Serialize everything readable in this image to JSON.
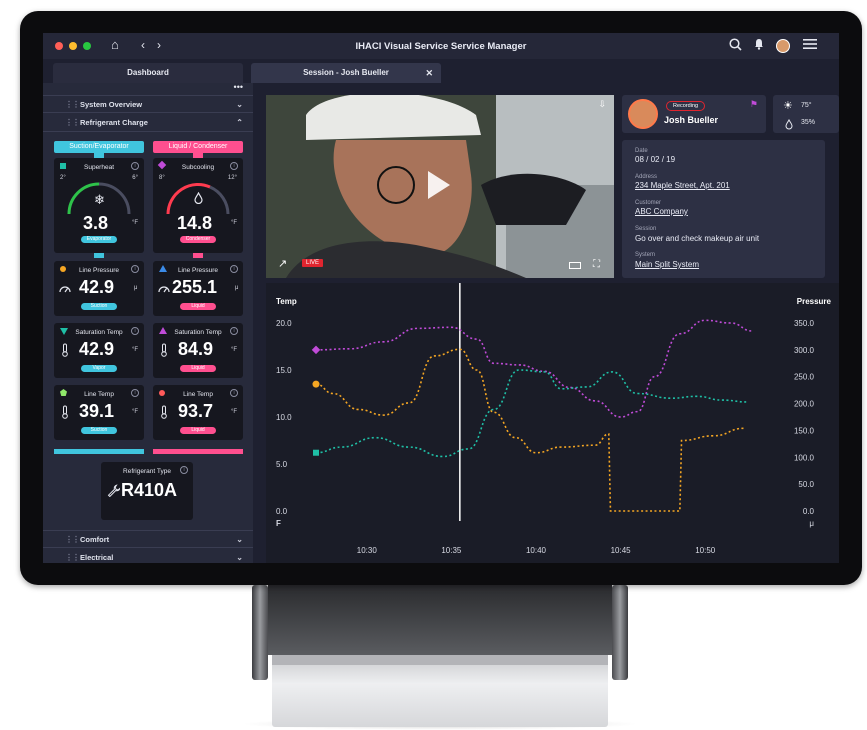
{
  "app": {
    "title": "IHACI Visual Service Service Manager"
  },
  "tabs": [
    {
      "label": "Dashboard"
    },
    {
      "label": "Session - Josh Bueller"
    }
  ],
  "sidebar": {
    "sections": {
      "system_overview": "System Overview",
      "refrigerant_charge": "Refrigerant Charge",
      "comfort": "Comfort",
      "electrical": "Electrical"
    },
    "column_labels": {
      "left": "Suction/Evaporator",
      "right": "Liquid / Condenser"
    },
    "superheat": {
      "title": "Superheat",
      "value": "3.8",
      "unit": "°F",
      "tag": "Evaporator",
      "min": "2°",
      "max": "6°"
    },
    "subcooling": {
      "title": "Subcooling",
      "value": "14.8",
      "unit": "°F",
      "tag": "Condenser",
      "min": "8°",
      "max": "12°"
    },
    "line_pressure_left": {
      "title": "Line Pressure",
      "value": "42.9",
      "unit": "μ",
      "tag": "Suction"
    },
    "line_pressure_right": {
      "title": "Line Pressure",
      "value": "255.1",
      "unit": "μ",
      "tag": "Liquid"
    },
    "sat_temp_left": {
      "title": "Saturation Temp",
      "value": "42.9",
      "unit": "°F",
      "tag": "Vapor"
    },
    "sat_temp_right": {
      "title": "Saturation Temp",
      "value": "84.9",
      "unit": "°F",
      "tag": "Liquid"
    },
    "line_temp_left": {
      "title": "Line Temp",
      "value": "39.1",
      "unit": "°F",
      "tag": "Suction"
    },
    "line_temp_right": {
      "title": "Line Temp",
      "value": "93.7",
      "unit": "°F",
      "tag": "Liquid"
    },
    "refrigerant_type": {
      "title": "Refrigerant Type",
      "value": "R410A"
    }
  },
  "video": {
    "live_label": "LIVE"
  },
  "tech": {
    "recording_label": "Recording",
    "name": "Josh Bueller"
  },
  "weather": {
    "temp": "75°",
    "humidity": "35%"
  },
  "details": {
    "date_label": "Date",
    "date": "08 / 02 / 19",
    "address_label": "Address",
    "address": "234 Maple Street, Apt. 201",
    "customer_label": "Customer",
    "customer": "ABC Company",
    "session_label": "Session",
    "session": "Go over and check makeup air unit",
    "system_label": "System",
    "system": "Main Split System"
  },
  "colors": {
    "cyan": "#40c5de",
    "pink": "#ff4f8f",
    "purple": "#c04bd8",
    "orange": "#f5a623",
    "teal": "#1fbfa6",
    "video_line": "#ffffff"
  },
  "chart_data": {
    "type": "line",
    "left_axis_title": "Temp",
    "right_axis_title": "Pressure",
    "left_unit": "F",
    "right_unit": "μ",
    "left_ticks": [
      "20.0",
      "15.0",
      "10.0",
      "5.0",
      "0.0"
    ],
    "right_ticks": [
      "350.0",
      "300.0",
      "250.0",
      "200.0",
      "150.0",
      "100.0",
      "50.0",
      "0.0"
    ],
    "x_ticks": [
      "10:30",
      "10:35",
      "10:40",
      "10:45",
      "10:50"
    ],
    "left_ylim": [
      0,
      20
    ],
    "right_ylim": [
      0,
      350
    ],
    "x_range": [
      "10:27",
      "10:53"
    ],
    "cursor_time": "10:35:30",
    "series": [
      {
        "color": "purple",
        "axis": "right",
        "points": [
          [
            27.0,
            300
          ],
          [
            29.0,
            302
          ],
          [
            31.0,
            315
          ],
          [
            33.0,
            340
          ],
          [
            35.0,
            342
          ],
          [
            36.5,
            320
          ],
          [
            37.5,
            275
          ],
          [
            39.0,
            272
          ],
          [
            40.5,
            260
          ],
          [
            42.0,
            230
          ],
          [
            43.5,
            205
          ],
          [
            45.0,
            175
          ],
          [
            46.0,
            185
          ],
          [
            47.0,
            250
          ],
          [
            48.5,
            330
          ],
          [
            50.0,
            355
          ],
          [
            51.5,
            350
          ],
          [
            52.8,
            335
          ]
        ]
      },
      {
        "color": "orange",
        "axis": "left",
        "points": [
          [
            27.0,
            13.5
          ],
          [
            28.0,
            12.5
          ],
          [
            29.5,
            10.8
          ],
          [
            31.0,
            10.2
          ],
          [
            32.5,
            11.5
          ],
          [
            34.0,
            16.5
          ],
          [
            35.5,
            17.2
          ],
          [
            36.5,
            15.0
          ],
          [
            37.5,
            10.5
          ],
          [
            38.8,
            7.8
          ],
          [
            40.0,
            6.2
          ],
          [
            41.5,
            6.8
          ],
          [
            43.5,
            7.0
          ],
          [
            44.3,
            8.2
          ],
          [
            44.4,
            0.0
          ],
          [
            48.5,
            0.0
          ],
          [
            48.6,
            7.5
          ],
          [
            50.5,
            8.0
          ],
          [
            52.3,
            8.8
          ]
        ]
      },
      {
        "color": "teal",
        "axis": "left",
        "points": [
          [
            27.0,
            6.2
          ],
          [
            28.5,
            6.8
          ],
          [
            30.5,
            7.8
          ],
          [
            32.5,
            6.8
          ],
          [
            34.5,
            5.8
          ],
          [
            36.0,
            6.6
          ],
          [
            37.5,
            10.8
          ],
          [
            39.0,
            15.0
          ],
          [
            40.5,
            14.8
          ],
          [
            41.5,
            13.0
          ],
          [
            43.0,
            13.2
          ],
          [
            44.5,
            14.8
          ],
          [
            46.0,
            12.5
          ],
          [
            48.0,
            12.0
          ],
          [
            49.5,
            12.2
          ],
          [
            51.0,
            11.8
          ],
          [
            52.5,
            11.6
          ]
        ]
      }
    ]
  }
}
